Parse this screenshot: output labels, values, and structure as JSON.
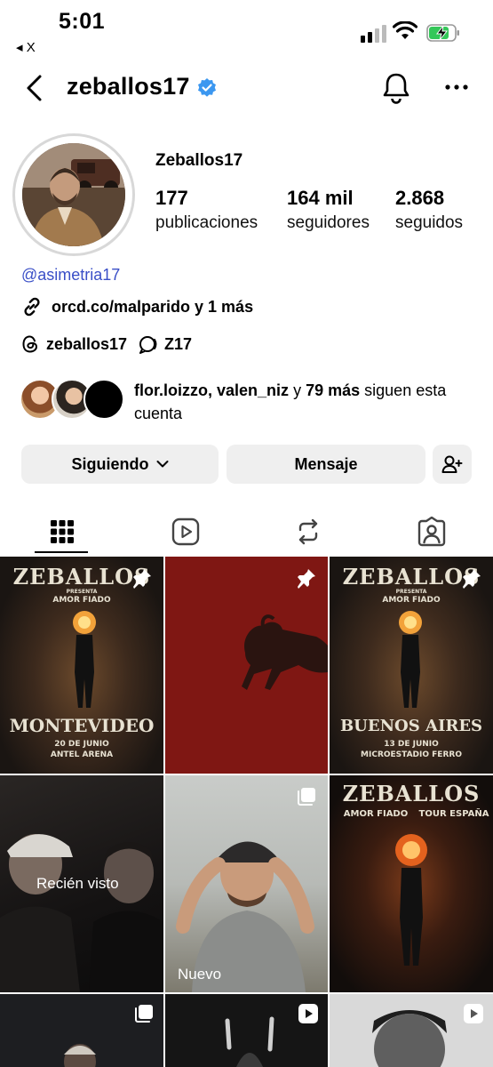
{
  "status_bar": {
    "time": "5:01",
    "back_app": "◂ X"
  },
  "header": {
    "username": "zeballos17"
  },
  "profile": {
    "display_name": "Zeballos17",
    "stats": [
      {
        "value": "177",
        "label": "publicaciones"
      },
      {
        "value": "164 mil",
        "label": "seguidores"
      },
      {
        "value": "2.868",
        "label": "seguidos"
      }
    ],
    "handle": "@asimetria17",
    "link": "orcd.co/malparido y 1 más",
    "threads_handle": "zeballos17",
    "channel": "Z17",
    "followed_by": {
      "users": "flor.loizzo, valen_niz",
      "connector": "y",
      "others": "79 más",
      "suffix": "siguen esta cuenta"
    }
  },
  "actions": {
    "following": "Siguiendo",
    "message": "Mensaje"
  },
  "grid": {
    "poster1": {
      "brand": "ZEBALLOS",
      "presenta": "PRESENTA",
      "tour": "AMOR FIADO",
      "city": "MONTEVIDEO",
      "date": "20 DE JUNIO",
      "venue": "ANTEL ARENA"
    },
    "poster3": {
      "brand": "ZEBALLOS",
      "presenta": "PRESENTA",
      "tour": "AMOR FIADO",
      "city": "BUENOS AIRES",
      "date": "13 DE JUNIO",
      "venue": "MICROESTADIO FERRO"
    },
    "poster6": {
      "brand": "ZEBALLOS",
      "tour": "AMOR FIADO",
      "tour2": "TOUR ESPAÑA"
    },
    "recent_label": "Recién visto",
    "new_label": "Nuevo"
  }
}
